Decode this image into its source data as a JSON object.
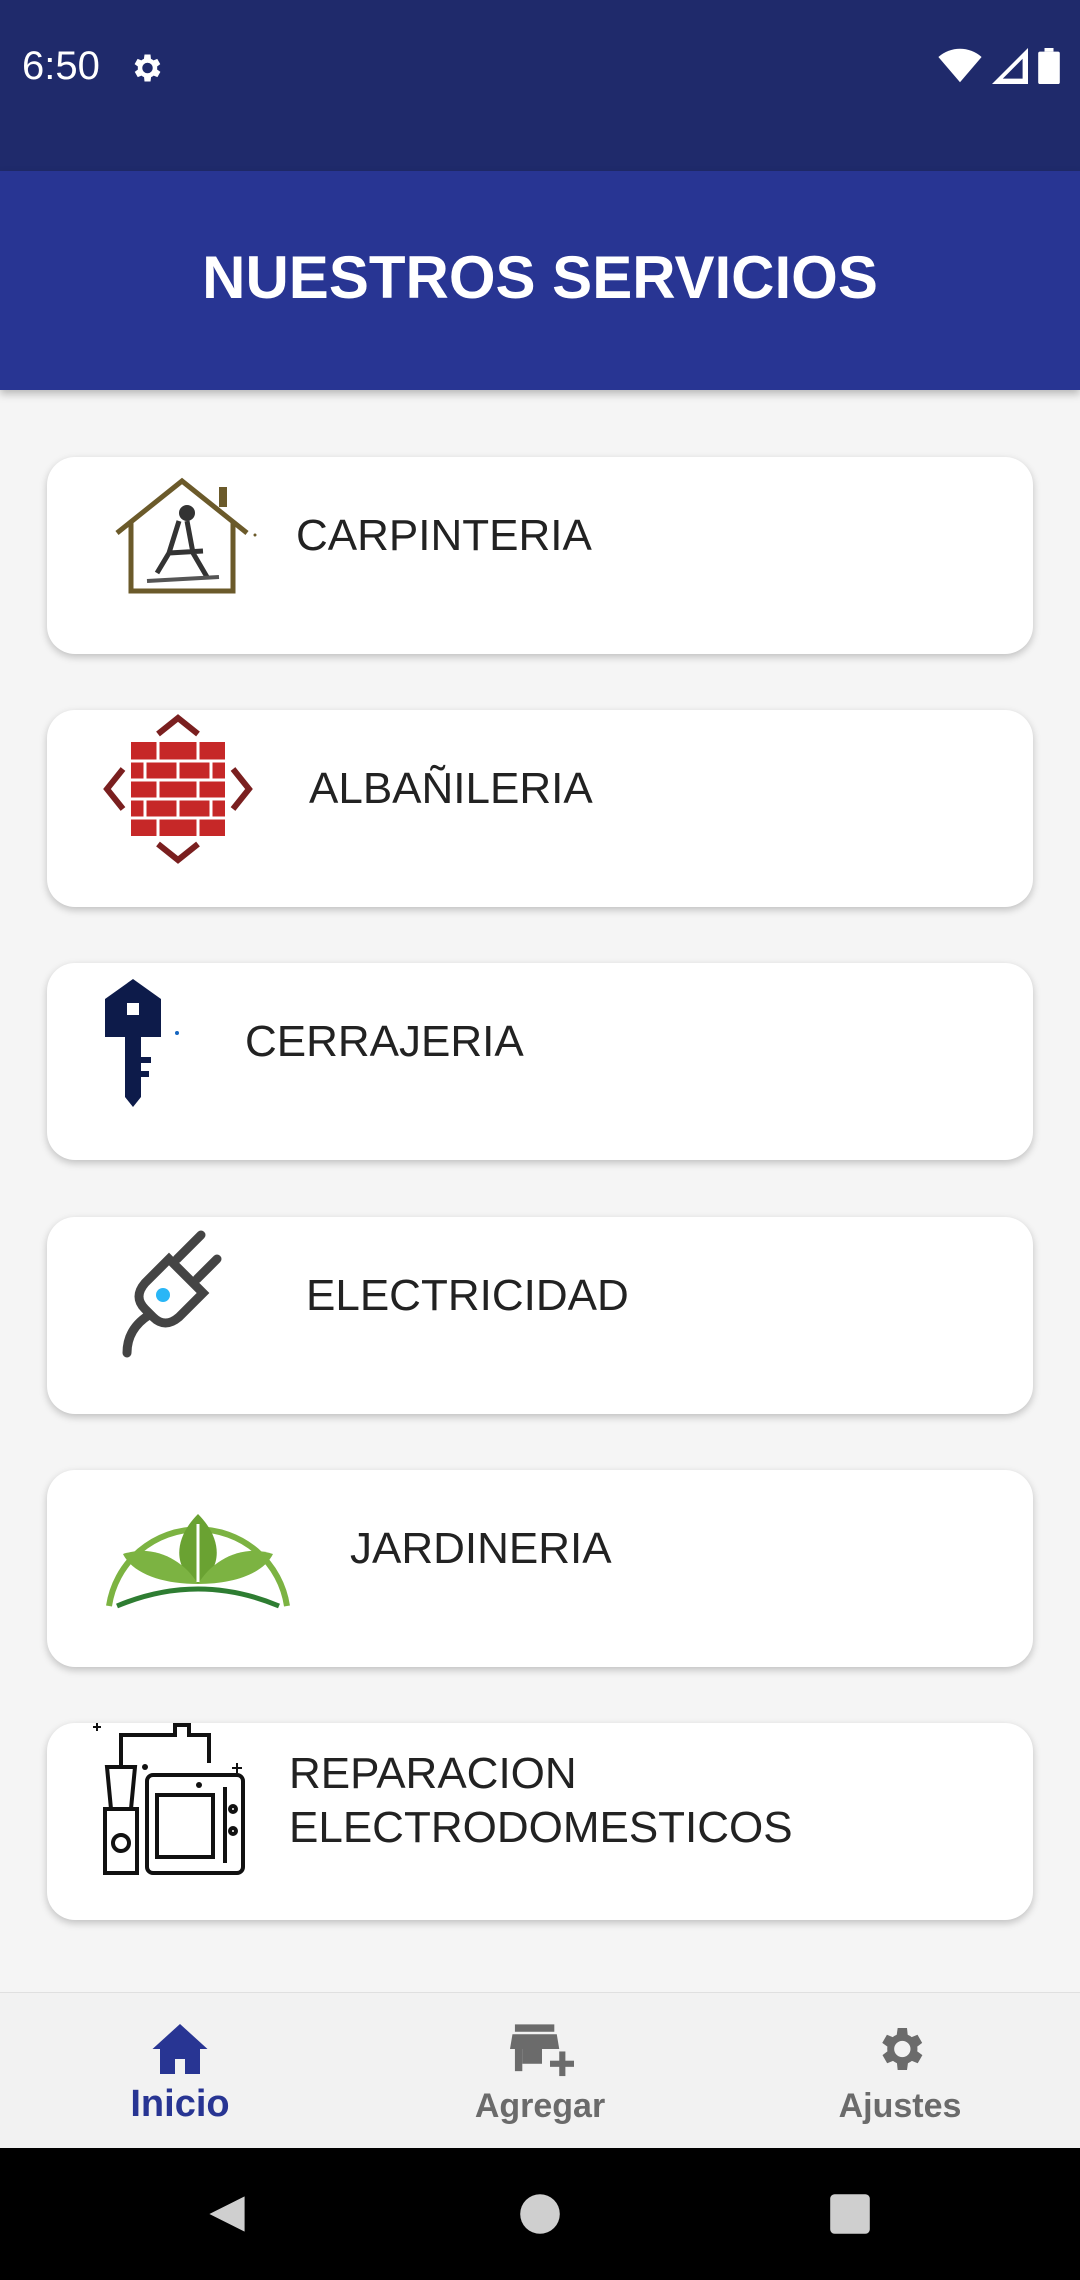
{
  "status_bar": {
    "time": "6:50"
  },
  "app_bar": {
    "title": "NUESTROS SERVICIOS"
  },
  "services": [
    {
      "label": "CARPINTERIA",
      "icon": "carpenter-house-icon"
    },
    {
      "label": "ALBAÑILERIA",
      "icon": "brick-wall-icon"
    },
    {
      "label": "CERRAJERIA",
      "icon": "house-key-icon"
    },
    {
      "label": "ELECTRICIDAD",
      "icon": "plug-icon"
    },
    {
      "label": "JARDINERIA",
      "icon": "leaves-icon"
    },
    {
      "label": "REPARACION\nELECTRODOMESTICOS",
      "icon": "appliances-icon"
    }
  ],
  "bottom_nav": {
    "items": [
      {
        "label": "Inicio",
        "icon": "home-icon",
        "active": true
      },
      {
        "label": "Agregar",
        "icon": "add-store-icon",
        "active": false
      },
      {
        "label": "Ajustes",
        "icon": "settings-icon",
        "active": false
      }
    ],
    "active_color": "#283593",
    "inactive_color": "#6b6b6b"
  },
  "colors": {
    "status_bar": "#1f2a6b",
    "app_bar": "#283593",
    "background": "#f5f5f5"
  }
}
